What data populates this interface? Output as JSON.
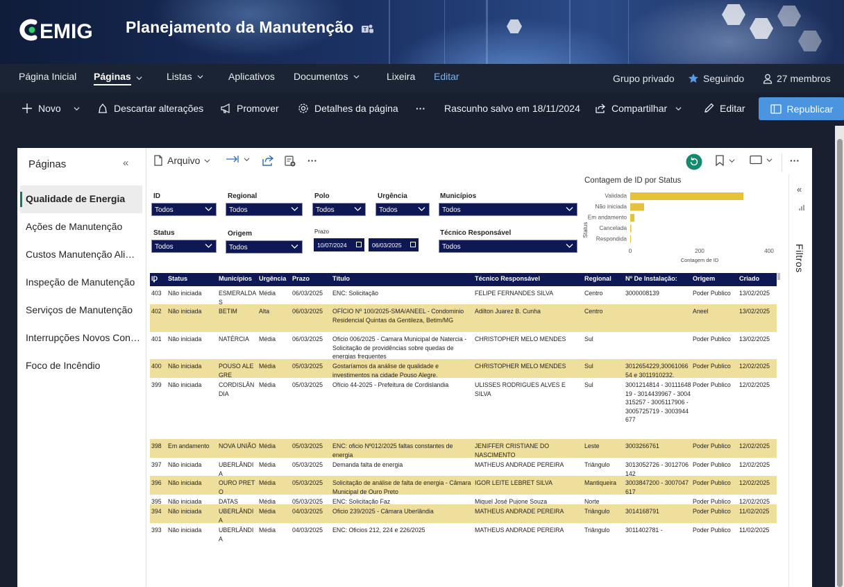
{
  "site": {
    "title": "Planejamento da Manutenção",
    "logo_text": "CEMIG"
  },
  "nav": {
    "items": [
      "Página Inicial",
      "Páginas",
      "Listas",
      "Aplicativos",
      "Documentos",
      "Lixeira",
      "Editar"
    ],
    "private_group": "Grupo privado",
    "following": "Seguindo",
    "members": "27 membros"
  },
  "commands": {
    "new": "Novo",
    "discard": "Descartar alterações",
    "promote": "Promover",
    "page_details": "Detalhes da página",
    "more": "···",
    "draft_saved": "Rascunho salvo em 18/11/2024",
    "share": "Compartilhar",
    "edit": "Editar",
    "republish": "Republicar"
  },
  "sidebar": {
    "title": "Páginas",
    "items": [
      {
        "label": "Qualidade de Energia",
        "active": true
      },
      {
        "label": "Ações de Manutenção"
      },
      {
        "label": "Custos Manutenção Alimentadores"
      },
      {
        "label": "Inspeção de Manutenção"
      },
      {
        "label": "Serviços de Manutenção"
      },
      {
        "label": "Interrupções Novos Consumidores"
      },
      {
        "label": "Foco de Incêndio"
      }
    ]
  },
  "report_toolbar": {
    "file": "Arquivo",
    "more": "···"
  },
  "filters_pane": {
    "label": "Filtros"
  },
  "slicers": {
    "id": {
      "label": "ID",
      "value": "Todos"
    },
    "regional": {
      "label": "Regional",
      "value": "Todos"
    },
    "polo": {
      "label": "Polo",
      "value": "Todos"
    },
    "urgencia": {
      "label": "Urgência",
      "value": "Todos"
    },
    "municipios": {
      "label": "Municípios",
      "value": "Todos"
    },
    "status": {
      "label": "Status",
      "value": "Todos"
    },
    "origem": {
      "label": "Origem",
      "value": "Todos"
    },
    "prazo": {
      "label": "Prazo",
      "from": "10/07/2024",
      "to": "06/03/2025"
    },
    "tecnico": {
      "label": "Técnico Responsável",
      "value": "Todos"
    }
  },
  "chart_data": {
    "type": "bar",
    "orientation": "horizontal",
    "title": "Contagem de ID por Status",
    "xlabel": "Contagem de ID",
    "ylabel": "Status",
    "categories": [
      "Validada",
      "Não iniciada",
      "Em andamento",
      "Cancelada",
      "Respondida"
    ],
    "values": [
      326,
      40,
      12,
      3,
      2
    ],
    "xlim": [
      0,
      400
    ],
    "xticks": [
      0,
      200,
      400
    ],
    "color": "#e6c13a"
  },
  "table": {
    "columns": [
      "ID",
      "Status",
      "Municípios",
      "Urgência",
      "Prazo",
      "Título",
      "Técnico Responsável",
      "Regional",
      "Nº De Instalação:",
      "Origem",
      "Criado"
    ],
    "rows": [
      {
        "id": "403",
        "status": "Não iniciada",
        "municipio": "ESMERALDAS",
        "urgencia": "Média",
        "prazo": "06/03/2025",
        "titulo": "ENC: Solicitação",
        "tecnico": "FELIPE FERNANDES SILVA",
        "regional": "Centro",
        "instalacao": "3000008139",
        "origem": "Poder Publico",
        "criado": "13/02/2025"
      },
      {
        "id": "402",
        "status": "Não iniciada",
        "municipio": "BETIM",
        "urgencia": "Alta",
        "prazo": "06/03/2025",
        "titulo": "OFÍCIO Nº 100/2025-SMA/ANEEL - Condominio Residencial Quintas da Gentileza, Betim/MG",
        "tecnico": "Adilton Juarez B. Cunha",
        "regional": "Centro",
        "instalacao": "",
        "origem": "Aneel",
        "criado": "13/02/2025"
      },
      {
        "id": "401",
        "status": "Não iniciada",
        "municipio": "NATÉRCIA",
        "urgencia": "Média",
        "prazo": "06/03/2025",
        "titulo": "Oficio 006/2025 - Camara Municipal de Natercia - Solicitação de providências sobre quedas de energias frequentes",
        "tecnico": "CHRISTOPHER MELO MENDES",
        "regional": "Sul",
        "instalacao": "",
        "origem": "Poder Publico",
        "criado": "13/02/2025"
      },
      {
        "id": "400",
        "status": "Não iniciada",
        "municipio": "POUSO ALEGRE",
        "urgencia": "Média",
        "prazo": "05/03/2025",
        "titulo": "Gostaríamos da análise de qualidade e investimentos na cidade Pouso Alegre.",
        "tecnico": "CHRISTOPHER MELO MENDES",
        "regional": "Sul",
        "instalacao": "3012654229,3006106654 e 3011910232.",
        "origem": "Poder Publico",
        "criado": "12/02/2025"
      },
      {
        "id": "399",
        "status": "Não iniciada",
        "municipio": "CORDISLÂNDIA",
        "urgencia": "Média",
        "prazo": "05/03/2025",
        "titulo": "Ofício 44-2025 - Prefeitura de Cordislandia",
        "tecnico": "ULISSES RODRIGUES ALVES E SILVA",
        "regional": "Sul",
        "instalacao": "3001214814 - 3011164819 - 3014439967 - 3004315257 - 3005117906 - 3005725719 - 3003944677",
        "origem": "Poder Publico",
        "criado": "12/02/2025"
      },
      {
        "id": "398",
        "status": "Em andamento",
        "municipio": "NOVA UNIÃO",
        "urgencia": "Média",
        "prazo": "05/03/2025",
        "titulo": "ENC: oficio Nº012/2025 faltas constantes de energia",
        "tecnico": "JENIFFER CRISTIANE DO NASCIMENTO",
        "regional": "Leste",
        "instalacao": "3003266761",
        "origem": "Poder Publico",
        "criado": "12/02/2025"
      },
      {
        "id": "397",
        "status": "Não iniciada",
        "municipio": "UBERLÂNDIA",
        "urgencia": "Média",
        "prazo": "05/03/2025",
        "titulo": "Demanda falta de energia",
        "tecnico": "MATHEUS ANDRADE PEREIRA",
        "regional": "Triângulo",
        "instalacao": "3013052726 - 3012706142",
        "origem": "Poder Publico",
        "criado": "12/02/2025"
      },
      {
        "id": "396",
        "status": "Não iniciada",
        "municipio": "OURO PRETO",
        "urgencia": "Média",
        "prazo": "05/03/2025",
        "titulo": "Solicitação de análise de falta de energia - Câmara Municipal de Ouro Preto",
        "tecnico": "IGOR LEITE LEBRET SILVA",
        "regional": "Mantiqueira",
        "instalacao": "3003847200 - 3007047617",
        "origem": "Poder Publico",
        "criado": "12/02/2025"
      },
      {
        "id": "395",
        "status": "Não iniciada",
        "municipio": "DATAS",
        "urgencia": "Média",
        "prazo": "05/03/2025",
        "titulo": "ENC: Solicitação Faz",
        "tecnico": "Miguel José Pujone Souza",
        "regional": "Norte",
        "instalacao": "",
        "origem": "Poder Publico",
        "criado": "12/02/2025"
      },
      {
        "id": "394",
        "status": "Não iniciada",
        "municipio": "UBERLÂNDIA",
        "urgencia": "Média",
        "prazo": "04/03/2025",
        "titulo": "Oficio 239/2025 - Câmara Uberlândia",
        "tecnico": "MATHEUS ANDRADE PEREIRA",
        "regional": "Triângulo",
        "instalacao": "3014168791",
        "origem": "Poder Publico",
        "criado": "11/02/2025"
      },
      {
        "id": "393",
        "status": "Não iniciada",
        "municipio": "UBERLÂNDIA",
        "urgencia": "Média",
        "prazo": "04/03/2025",
        "titulo": "ENC: Oficios 212, 224 e 226/2025",
        "tecnico": "MATHEUS ANDRADE PEREIRA",
        "regional": "Triângulo",
        "instalacao": "3011402781 -",
        "origem": "Poder Publico",
        "criado": "11/02/2025"
      }
    ]
  }
}
